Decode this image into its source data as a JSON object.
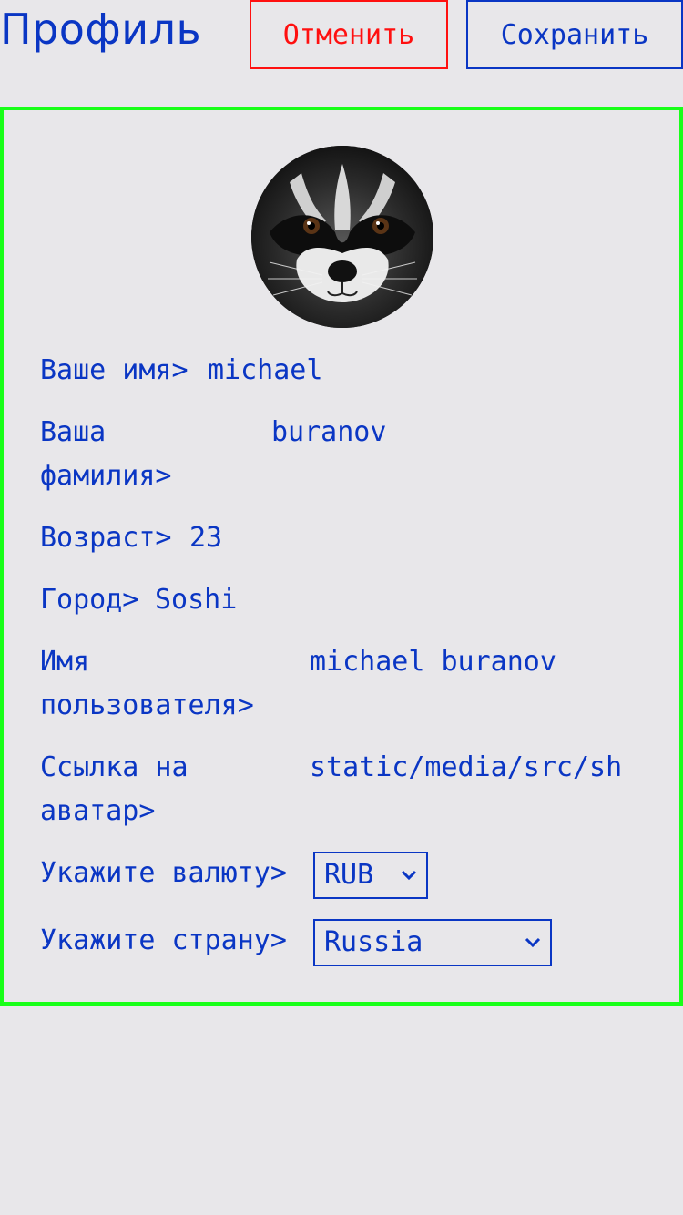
{
  "header": {
    "title": "Профиль",
    "cancel_label": "Отменить",
    "save_label": "Сохранить"
  },
  "profile": {
    "avatar_icon": "raccoon-avatar",
    "first_name_label": "Ваше имя>",
    "first_name_value": "michael",
    "last_name_label_line1": "Ваша",
    "last_name_label_line2": "фамилия>",
    "last_name_value": "buranov",
    "age_label": "Возраст>",
    "age_value": "23",
    "city_label": "Город>",
    "city_value": "Soshi",
    "username_label_line1": "Имя",
    "username_label_line2": "пользователя>",
    "username_value": "michael buranov",
    "avatar_link_label_line1": "Ссылка на",
    "avatar_link_label_line2": "аватар>",
    "avatar_link_value": "static/media/src/sh",
    "currency_label": "Укажите валюту>",
    "currency_value": "RUB",
    "country_label": "Укажите страну>",
    "country_value": "Russia"
  },
  "colors": {
    "text": "#0a36c4",
    "cancel": "#ff1010",
    "card_border": "#18ff18",
    "background": "#e8e7ea"
  }
}
